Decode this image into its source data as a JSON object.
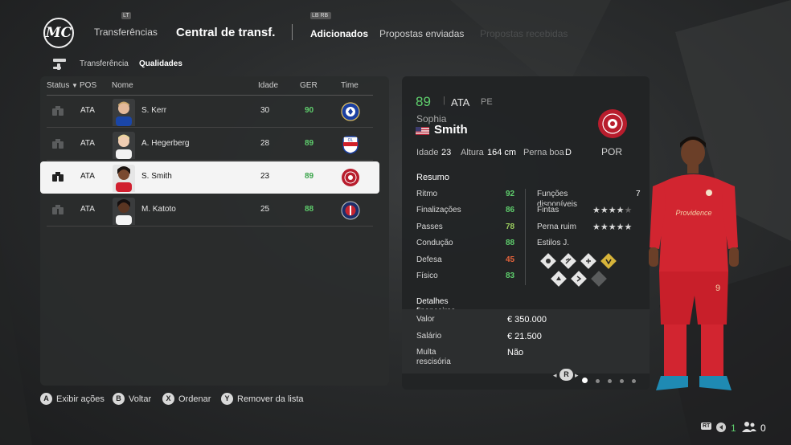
{
  "nav": {
    "lb_glyph": "LT",
    "section": "Transferências",
    "title": "Central de transf.",
    "bumper_glyph": "LB RB",
    "tabs": [
      {
        "label": "Adicionados",
        "state": "active"
      },
      {
        "label": "Propostas enviadas",
        "state": "normal"
      },
      {
        "label": "Propostas recebidas",
        "state": "disabled"
      }
    ]
  },
  "subnav": {
    "items": [
      {
        "label": "Transferência",
        "active": false
      },
      {
        "label": "Qualidades",
        "active": true
      }
    ]
  },
  "list": {
    "columns": [
      "Status",
      "POS",
      "Nome",
      "Idade",
      "GER",
      "Time"
    ],
    "rows": [
      {
        "pos": "ATA",
        "name": "S. Kerr",
        "age": "30",
        "ovr": "90",
        "club": "chelsea-crest"
      },
      {
        "pos": "ATA",
        "name": "A. Hegerberg",
        "age": "28",
        "ovr": "89",
        "club": "lyon-crest"
      },
      {
        "pos": "ATA",
        "name": "S. Smith",
        "age": "23",
        "ovr": "89",
        "club": "portland-thorns-crest",
        "selected": true
      },
      {
        "pos": "ATA",
        "name": "M. Katoto",
        "age": "25",
        "ovr": "88",
        "club": "psg-crest"
      }
    ]
  },
  "detail": {
    "ovr": "89",
    "pos": "ATA",
    "alt_pos": "PE",
    "first_name": "Sophia",
    "last_name": "Smith",
    "flag": "usa-flag",
    "club_short": "POR",
    "age_label": "Idade",
    "age": "23",
    "height_label": "Altura",
    "height": "164 cm",
    "foot_label": "Perna boa",
    "foot": "D",
    "summary_title": "Resumo",
    "stats": [
      {
        "label": "Ritmo",
        "value": "92",
        "color": "#5fcf6d"
      },
      {
        "label": "Finalizações",
        "value": "86",
        "color": "#5fcf6d"
      },
      {
        "label": "Passes",
        "value": "78",
        "color": "#9ccf5f"
      },
      {
        "label": "Condução",
        "value": "88",
        "color": "#5fcf6d"
      },
      {
        "label": "Defesa",
        "value": "45",
        "color": "#e8643c"
      },
      {
        "label": "Físico",
        "value": "83",
        "color": "#5fcf6d"
      }
    ],
    "functions_label": "Funções disponíveis",
    "functions_value": "7",
    "skill_moves_label": "Fintas",
    "skill_moves": 4,
    "weak_foot_label": "Perna ruim",
    "weak_foot": 5,
    "playstyles_label": "Estilos J.",
    "finance_title": "Detalhes financeiros",
    "finance": [
      {
        "label": "Valor",
        "value": "€ 350.000"
      },
      {
        "label": "Salário",
        "value": "€ 21.500"
      },
      {
        "label": "Multa rescisória",
        "value": "Não"
      }
    ],
    "page_glyph": "R",
    "pages": 5,
    "page_active": 1
  },
  "hints": [
    {
      "button": "A",
      "label": "Exibir ações"
    },
    {
      "button": "B",
      "label": "Voltar"
    },
    {
      "button": "X",
      "label": "Ordenar"
    },
    {
      "button": "Y",
      "label": "Remover da lista"
    }
  ],
  "footer": {
    "rt_glyph": "RT",
    "count_a": "1",
    "count_b": "0"
  },
  "colors": {
    "accent_green": "#5fcf6d",
    "low_red": "#e8643c",
    "selected_row": "#f4f4f4",
    "panel": "#2a2c2d"
  }
}
